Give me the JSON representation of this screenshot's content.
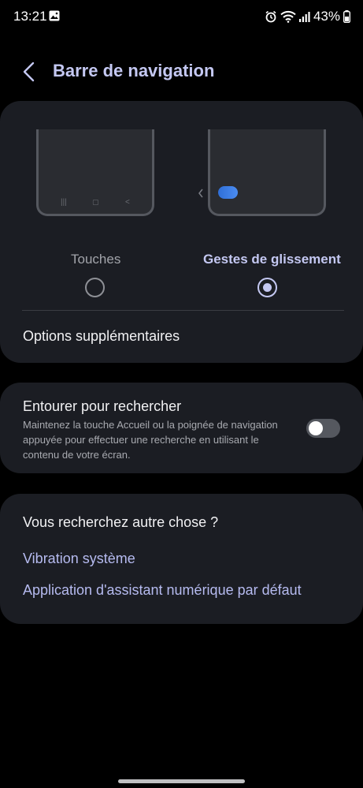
{
  "status_bar": {
    "time": "13:21",
    "battery_percent": "43%",
    "icons": [
      "gallery-icon",
      "alarm-icon",
      "wifi-icon",
      "signal-icon",
      "battery-icon"
    ]
  },
  "header": {
    "title": "Barre de navigation"
  },
  "navigation_types": {
    "options": [
      {
        "label": "Touches",
        "selected": false
      },
      {
        "label": "Gestes de glissement",
        "selected": true
      }
    ],
    "more_options_label": "Options supplémentaires"
  },
  "circle_to_search": {
    "title": "Entourer pour rechercher",
    "description": "Maintenez la touche Accueil ou la poignée de navigation appuyée pour effectuer une recherche en utilisant le contenu de votre écran.",
    "enabled": false
  },
  "suggestions": {
    "title": "Vous recherchez autre chose ?",
    "links": [
      "Vibration système",
      "Application d'assistant numérique par défaut"
    ]
  },
  "colors": {
    "accent": "#c4c8f2",
    "link": "#b6bbf0",
    "card_bg": "#1b1d23",
    "background": "#000000"
  }
}
